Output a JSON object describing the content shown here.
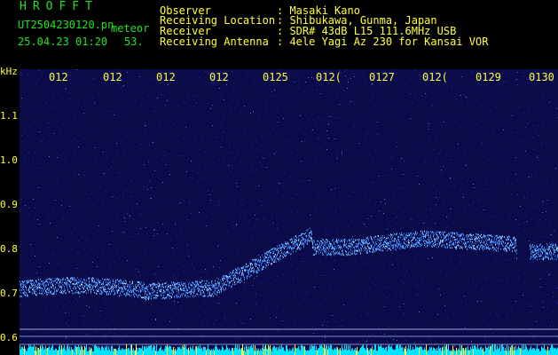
{
  "header": {
    "brand": "HROFFT",
    "filename": "UT2504230120.pn",
    "meteor_label": "meteor",
    "datetime": "25.04.23 01:20",
    "count": "53.",
    "fields": [
      {
        "label": "Observer",
        "value": ": Masaki Kano"
      },
      {
        "label": "Receiving Location",
        "value": ": Shibukawa, Gunma, Japan"
      },
      {
        "label": "Receiver",
        "value": ": SDR# 43dB L15 111.6MHz USB"
      },
      {
        "label": "Receiving Antenna",
        "value": ": 4ele Yagi Az 230 for Kansai VOR"
      }
    ]
  },
  "axis": {
    "unit": "kHz",
    "y_labels": [
      "1.1",
      "1.0",
      "0.9",
      "0.8",
      "0.7",
      "0.6"
    ],
    "time_labels": [
      "012",
      "012",
      "012",
      "012",
      "0125",
      "012(",
      "0127",
      "012(",
      "0129",
      "0130"
    ]
  },
  "colors": {
    "text_green": "#1fe31f",
    "text_yellow": "#ffff3a",
    "background": "#0b0b4a",
    "signal": "#4fa8ff",
    "noise_cyan": "#00e5ff"
  }
}
